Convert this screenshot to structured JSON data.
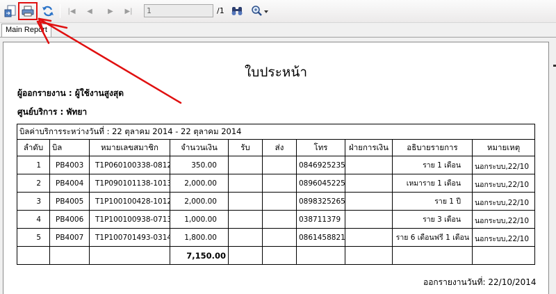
{
  "toolbar": {
    "page_input_value": "1",
    "page_total": "/1",
    "buttons": [
      "export-icon",
      "print-icon",
      "refresh-icon",
      "first-page-icon",
      "previous-page-icon",
      "next-page-icon",
      "last-page-icon",
      "find-icon",
      "zoom-icon"
    ]
  },
  "tabs": [
    {
      "label": "Main Report"
    }
  ],
  "report": {
    "title": "ใบประหน้า",
    "reporter_label": "ผู้ออกรายงาน :",
    "reporter_value": "ผู้ใช้งานสูงสุด",
    "center_label": "ศูนย์บริการ :",
    "center_value": "พัทยา",
    "period_text": "บิลค่าบริการระหว่างวันที่ : 22 ตุลาคม 2014 - 22 ตุลาคม 2014",
    "columns": [
      "ลำดับ",
      "บิล",
      "หมายเลขสมาชิก",
      "จำนวนเงิน",
      "รับ",
      "ส่ง",
      "โทร",
      "ฝ่ายการเงิน",
      "อธิบายรายการ",
      "หมายเหตุ"
    ],
    "rows": [
      {
        "no": "1",
        "bill": "PB4003",
        "member": "T1P060100338-0812",
        "amount": "350.00",
        "receive": "",
        "send": "",
        "phone": "0846925235",
        "finance": "",
        "desc": "ราย 1 เดือน",
        "remark": "นอกระบบ,22/10"
      },
      {
        "no": "2",
        "bill": "PB4004",
        "member": "T1P090101138-1013",
        "amount": "2,000.00",
        "receive": "",
        "send": "",
        "phone": "0896045225",
        "finance": "",
        "desc": "เหมาราย 1 เดือน",
        "remark": "นอกระบบ,22/10"
      },
      {
        "no": "3",
        "bill": "PB4005",
        "member": "T1P100100428-1012",
        "amount": "2,000.00",
        "receive": "",
        "send": "",
        "phone": "0898325265",
        "finance": "",
        "desc": "ราย 1 ปี",
        "remark": "นอกระบบ,22/10"
      },
      {
        "no": "4",
        "bill": "PB4006",
        "member": "T1P100100938-0713",
        "amount": "1,000.00",
        "receive": "",
        "send": "",
        "phone": "038711379",
        "finance": "",
        "desc": "ราย 3 เดือน",
        "remark": "นอกระบบ,22/10"
      },
      {
        "no": "5",
        "bill": "PB4007",
        "member": "T1P100701493-0314",
        "amount": "1,800.00",
        "receive": "",
        "send": "",
        "phone": "0861458821",
        "finance": "",
        "desc": "ราย 6 เดือนฟรี 1 เดือน",
        "remark": "นอกระบบ,22/10"
      }
    ],
    "total_amount": "7,150.00",
    "footer": "ออกรายงานวันที่: 22/10/2014"
  },
  "annotation_color": "#e01010"
}
